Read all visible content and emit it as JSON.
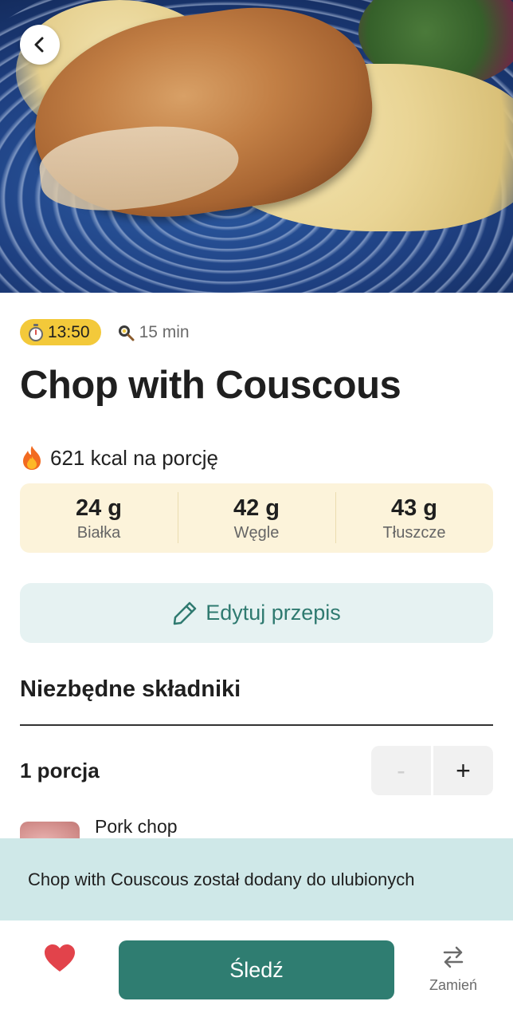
{
  "recipe": {
    "time_badge": "13:50",
    "duration": "15 min",
    "title": "Chop with Couscous",
    "kcal": "621 kcal na porcję",
    "macros": [
      {
        "value": "24 g",
        "label": "Białka"
      },
      {
        "value": "42 g",
        "label": "Węgle"
      },
      {
        "value": "43 g",
        "label": "Tłuszcze"
      }
    ]
  },
  "edit_button": {
    "label": "Edytuj przepis"
  },
  "ingredients_section": {
    "title": "Niezbędne składniki",
    "portion_label": "1 porcja",
    "stepper": {
      "minus": "-",
      "plus": "+"
    },
    "items": [
      {
        "name": "Pork chop"
      }
    ]
  },
  "toast": {
    "message": "Chop with Couscous został dodany do ulubionych"
  },
  "bottom_bar": {
    "track_label": "Śledź",
    "swap_label": "Zamień"
  },
  "colors": {
    "accent": "#2f7d71",
    "badge": "#f3c93a",
    "macro_bg": "#fcf3da",
    "toast_bg": "#cfe8e8",
    "favorite": "#e2434b"
  },
  "icons": [
    "back-arrow-icon",
    "stopwatch-icon",
    "pan-icon",
    "fire-icon",
    "pencil-icon",
    "heart-icon",
    "swap-arrows-icon"
  ]
}
